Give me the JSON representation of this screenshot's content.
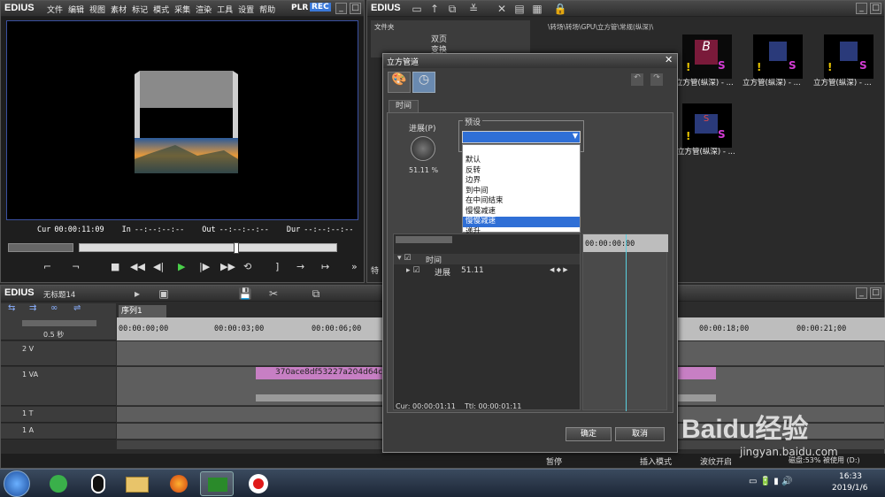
{
  "left_window": {
    "app": "EDIUS",
    "menu": [
      "文件",
      "编辑",
      "视图",
      "素材",
      "标记",
      "模式",
      "采集",
      "渲染",
      "工具",
      "设置",
      "帮助"
    ],
    "mode_plr": "PLR",
    "mode_rec": "REC",
    "timecodes": {
      "cur_label": "Cur",
      "cur": "00:00:11:09",
      "in_label": "In",
      "in": "--:--:--:--",
      "out_label": "Out",
      "out": "--:--:--:--",
      "dur_label": "Dur",
      "dur": "--:--:--:--"
    }
  },
  "right_window": {
    "app": "EDIUS",
    "folder_label": "文件夹",
    "tree": [
      "双页",
      "变换"
    ],
    "path": "\\转场\\转场\\GPU\\立方管\\常规(纵深)\\",
    "thumbs": [
      "立方管(纵深) - ...",
      "立方管(纵深) - ...",
      "立方管(纵深) - ...",
      "立方管(纵深) - ..."
    ],
    "side_label": "特"
  },
  "timeline_window": {
    "app": "EDIUS",
    "project": "无标题14",
    "sequence_tab": "序列1",
    "zoom_label": "0.5 秒",
    "ruler": [
      "00:00:00;00",
      "00:00:03;00",
      "00:00:06;00",
      "00:00:18;00",
      "00:00:21;00"
    ],
    "tracks": [
      {
        "name": "2 V"
      },
      {
        "name": "1 VA"
      },
      {
        "name": "1 T"
      },
      {
        "name": "1 A"
      }
    ],
    "clip_name": "370ace8df53227a204d64c76",
    "status": [
      "暂停",
      "插入模式",
      "波纹开启",
      "磁盘:53% 被使用 (D:)"
    ]
  },
  "dialog": {
    "title": "立方管道",
    "tab": "时间",
    "progress_label": "进展(P)",
    "progress_value": "51.11 %",
    "preset_label": "预设",
    "preset_options": [
      "默认",
      "反转",
      "边界",
      "到中间",
      "在中间结束",
      "慢慢减速",
      "慢慢减速",
      "递升"
    ],
    "highlighted_index": 6,
    "timeline_tc": "00:00:00:00",
    "tree_rows": [
      {
        "label": "时间"
      },
      {
        "label": "进展",
        "value": "51.11"
      }
    ],
    "cur_label": "Cur: 00:00:01:11",
    "ttl_label": "Ttl: 00:00:01:11",
    "ok": "确定",
    "cancel": "取消"
  },
  "taskbar": {
    "time": "16:33",
    "date": "2019/1/6"
  },
  "watermark": {
    "brand": "Baidu经验",
    "url": "jingyan.baidu.com"
  },
  "colors": {
    "accent": "#3a78d8",
    "clip": "#c77fc4",
    "highlight": "#2f6fd6"
  }
}
